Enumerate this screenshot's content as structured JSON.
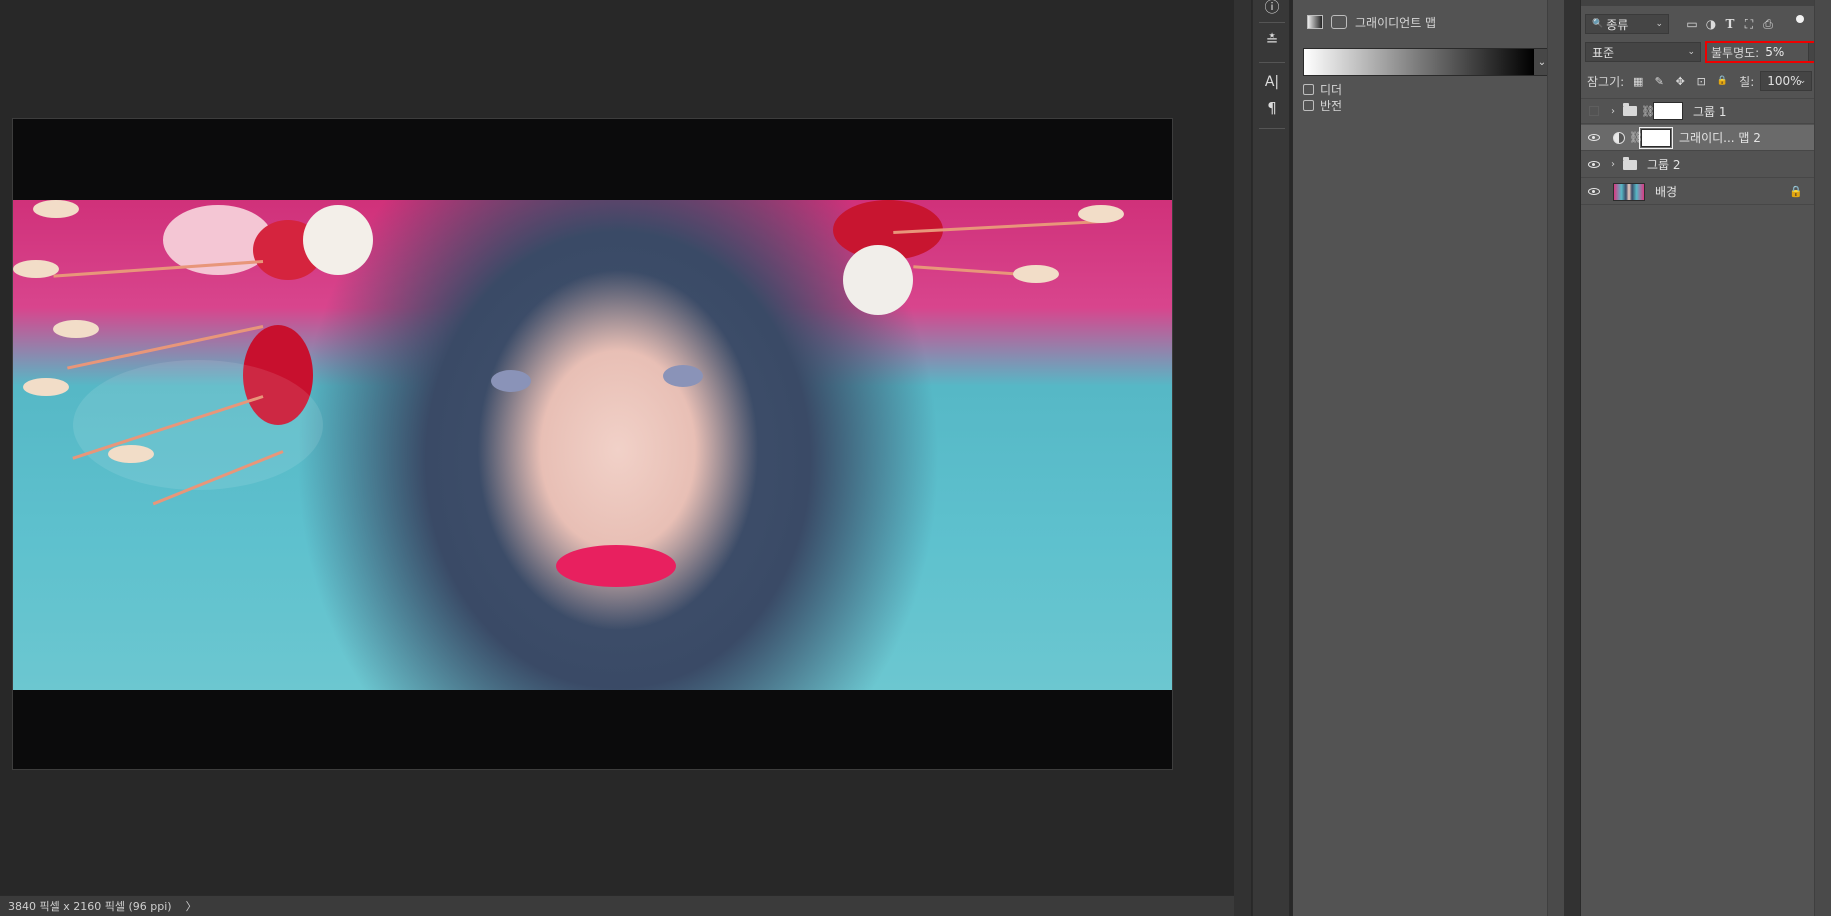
{
  "status_bar": {
    "doc_info": "3840 픽셀 x 2160 픽셀 (96 ppi)",
    "arrow": "〉"
  },
  "toolstrip": {
    "tools": [
      "info-icon",
      "clone-source-icon",
      "character-icon",
      "paragraph-icon"
    ],
    "glyphs": {
      "info": "ⓘ",
      "clone": "≛",
      "character": "A|",
      "paragraph": "¶"
    }
  },
  "properties": {
    "title": "그래이디언트 맵",
    "dropdown_arrow": "⌄",
    "options": [
      {
        "label": "디더",
        "checked": false
      },
      {
        "label": "반전",
        "checked": false
      }
    ]
  },
  "layers_panel": {
    "filter_label": "종류",
    "filter_icon": "🔍",
    "filter_icons": [
      "image-filter-icon",
      "adjustment-filter-icon",
      "type-filter-icon",
      "shape-filter-icon",
      "smart-object-filter-icon"
    ],
    "filter_glyphs": [
      "▭",
      "◑",
      "T",
      "⛶",
      "⎙"
    ],
    "blend_mode": "표준",
    "opacity_label": "불투명도:",
    "opacity_value": "5%",
    "lock_label": "잠그기:",
    "lock_icons": [
      "lock-transparent-icon",
      "lock-image-icon",
      "lock-position-icon",
      "lock-artboard-icon",
      "lock-all-icon"
    ],
    "lock_glyphs": [
      "▦",
      "✎",
      "✥",
      "⊡",
      "🔒"
    ],
    "fill_label": "칠:",
    "fill_value": "100%",
    "layers": [
      {
        "name": "그룹 1",
        "type": "group",
        "visible": false
      },
      {
        "name": "그래이디... 맵 2",
        "type": "adjustment",
        "visible": true,
        "selected": true
      },
      {
        "name": "그룹 2",
        "type": "group",
        "visible": true
      },
      {
        "name": "배경",
        "type": "background",
        "visible": true,
        "locked": true
      }
    ]
  },
  "colors": {
    "highlight_box": "#e00000",
    "panel_bg": "#535353",
    "canvas_bg": "#282828"
  }
}
